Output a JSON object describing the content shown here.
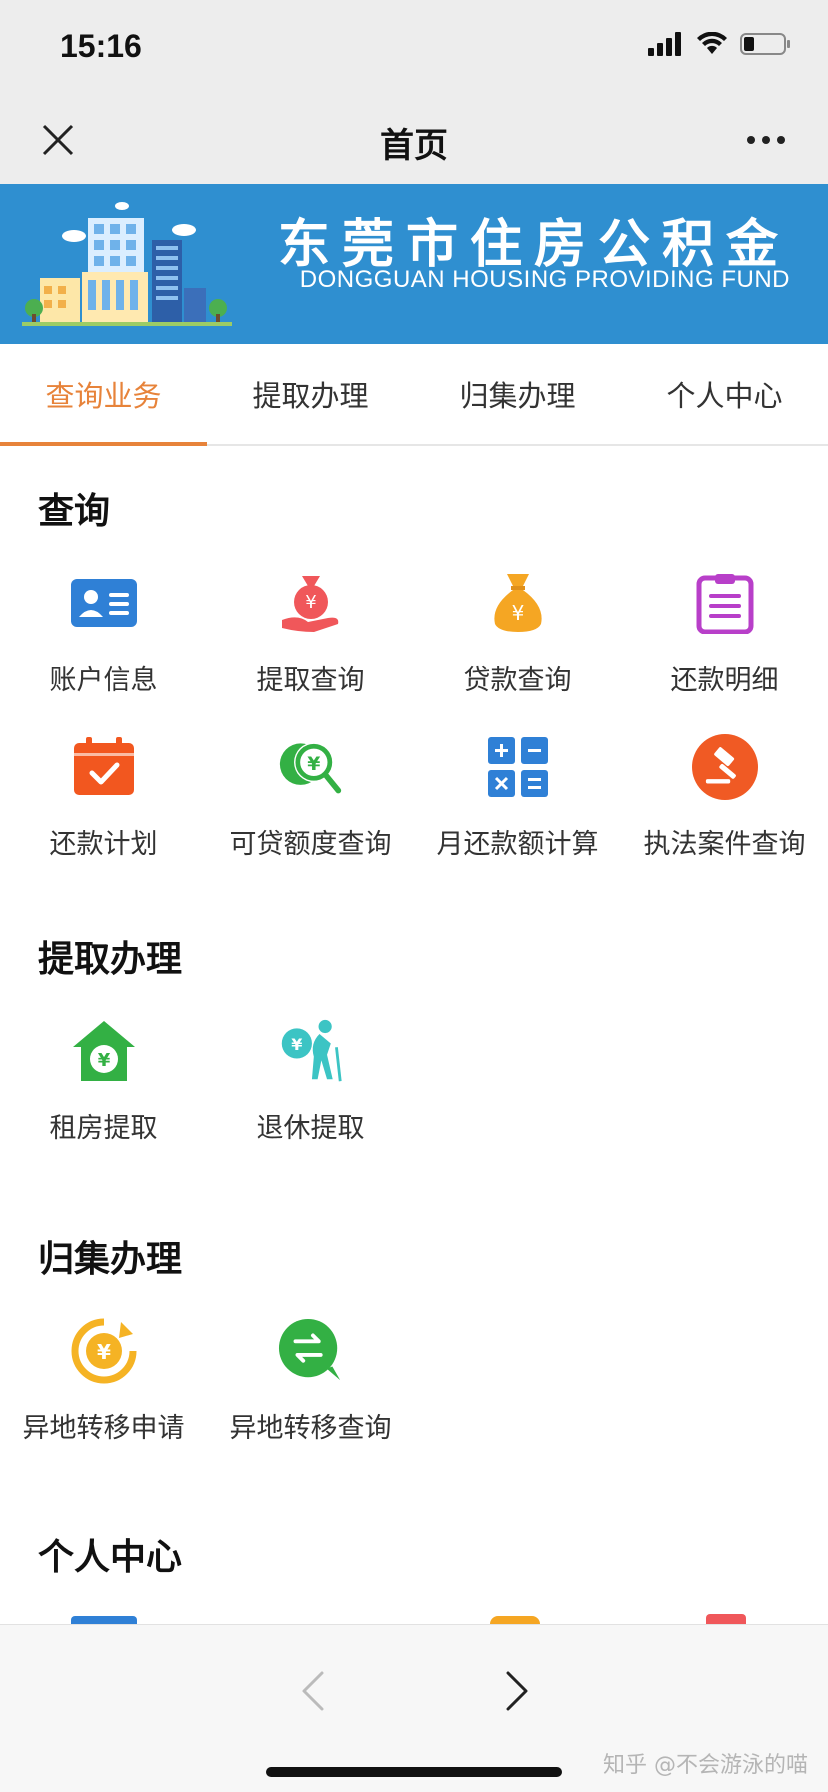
{
  "status_bar": {
    "time": "15:16",
    "icons": [
      "signal-icon",
      "wifi-icon",
      "battery-icon"
    ]
  },
  "nav": {
    "title": "首页",
    "close_icon": "close-icon",
    "more_icon": "more-icon"
  },
  "banner": {
    "title": "东莞市住房公积金",
    "subtitle": "DONGGUAN HOUSING PROVIDING FUND",
    "background": "#2f8fd0"
  },
  "tabs": [
    {
      "label": "查询业务",
      "active": true
    },
    {
      "label": "提取办理",
      "active": false
    },
    {
      "label": "归集办理",
      "active": false
    },
    {
      "label": "个人中心",
      "active": false
    }
  ],
  "accent_color": "#e7833a",
  "sections": {
    "query": {
      "title": "查询",
      "items": [
        {
          "label": "账户信息",
          "icon": "id-card-icon",
          "color": "#2f80d6"
        },
        {
          "label": "提取查询",
          "icon": "money-bag-hand-icon",
          "color": "#f0575a"
        },
        {
          "label": "贷款查询",
          "icon": "money-bag-icon",
          "color": "#f5a623"
        },
        {
          "label": "还款明细",
          "icon": "clipboard-icon",
          "color": "#b83fc9"
        },
        {
          "label": "还款计划",
          "icon": "calendar-check-icon",
          "color": "#f2571f"
        },
        {
          "label": "可贷额度查询",
          "icon": "coin-search-icon",
          "color": "#33b044"
        },
        {
          "label": "月还款额计算",
          "icon": "calculator-icon",
          "color": "#2f80d6"
        },
        {
          "label": "执法案件查询",
          "icon": "gavel-icon",
          "color": "#f05a24"
        }
      ]
    },
    "withdraw": {
      "title": "提取办理",
      "items": [
        {
          "label": "租房提取",
          "icon": "house-yen-icon",
          "color": "#33b044"
        },
        {
          "label": "退休提取",
          "icon": "elderly-icon",
          "color": "#3cc4c4"
        }
      ]
    },
    "collect": {
      "title": "归集办理",
      "items": [
        {
          "label": "异地转移申请",
          "icon": "yen-transfer-icon",
          "color": "#f5b324"
        },
        {
          "label": "异地转移查询",
          "icon": "transfer-search-icon",
          "color": "#33b044"
        }
      ]
    },
    "personal": {
      "title": "个人中心"
    }
  },
  "bottom": {
    "back_icon": "chevron-left-icon",
    "forward_icon": "chevron-right-icon",
    "watermark": "知乎 @不会游泳的喵"
  }
}
